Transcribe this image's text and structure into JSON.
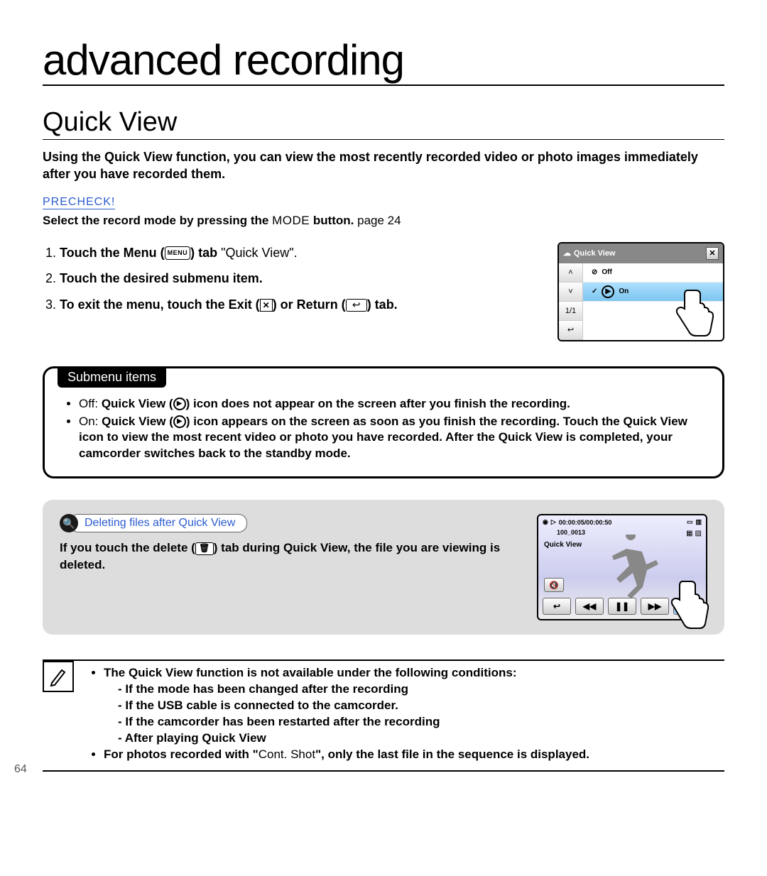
{
  "page": {
    "title": "advanced recording",
    "section": "Quick View",
    "number": "64"
  },
  "intro": "Using the Quick View function, you can view the most recently recorded video or photo images immediately after you have recorded them.",
  "precheck": {
    "label": "PRECHECK!",
    "text_before": "Select the record mode by pressing the ",
    "mode": "MODE",
    "text_after": " button. ",
    "page_ref": "page 24"
  },
  "steps": {
    "s1a": "Touch the Menu (",
    "s1_menu": "MENU",
    "s1b": ") tab ",
    "s1_arrow": " ",
    "s1_quote": "\"Quick View\".",
    "s2": "Touch the desired submenu item.",
    "s3a": "To exit the menu, touch the Exit (",
    "s3b": ") or Return (",
    "s3c": ") tab."
  },
  "lcd1": {
    "title": "Quick View",
    "close": "✕",
    "up": "˄",
    "down": "˅",
    "page": "1/1",
    "back": "↩",
    "row_off": "Off",
    "row_on": "On",
    "check": "✓"
  },
  "submenu": {
    "title": "Submenu items",
    "off_label": "Off: ",
    "off_a": "Quick View (",
    "off_b": ") icon does not appear on the screen after you finish the recording.",
    "on_label": "On: ",
    "on_a": "Quick View (",
    "on_b": ") icon appears on the screen as soon as you finish the recording. Touch the Quick View icon to view the most recent video or photo you have recorded. After the Quick View is completed, your camcorder switches back to the standby mode."
  },
  "delete": {
    "title": "Deleting files after Quick View",
    "text_a": "If you touch the delete (",
    "text_b": ") tab during Quick View, the file you are viewing is deleted."
  },
  "lcd2": {
    "time": "00:00:05/00:00:50",
    "file": "100_0013",
    "label": "Quick View",
    "play": "▷",
    "vol": "🔇",
    "back": "↩",
    "rew": "◀◀",
    "pause": "❚❚",
    "ff": "▶▶",
    "trash": "🗑"
  },
  "notes": {
    "n1": "The Quick View function is not available under the following conditions:",
    "d1": "If the mode has been changed after the recording",
    "d2": "If the USB cable is connected to the camcorder.",
    "d3": "If the camcorder has been restarted after the recording",
    "d4": "After playing Quick View",
    "n2a": "For photos recorded with \"",
    "n2_cont": "Cont. Shot",
    "n2b": "\", only the last file in the sequence is displayed."
  }
}
